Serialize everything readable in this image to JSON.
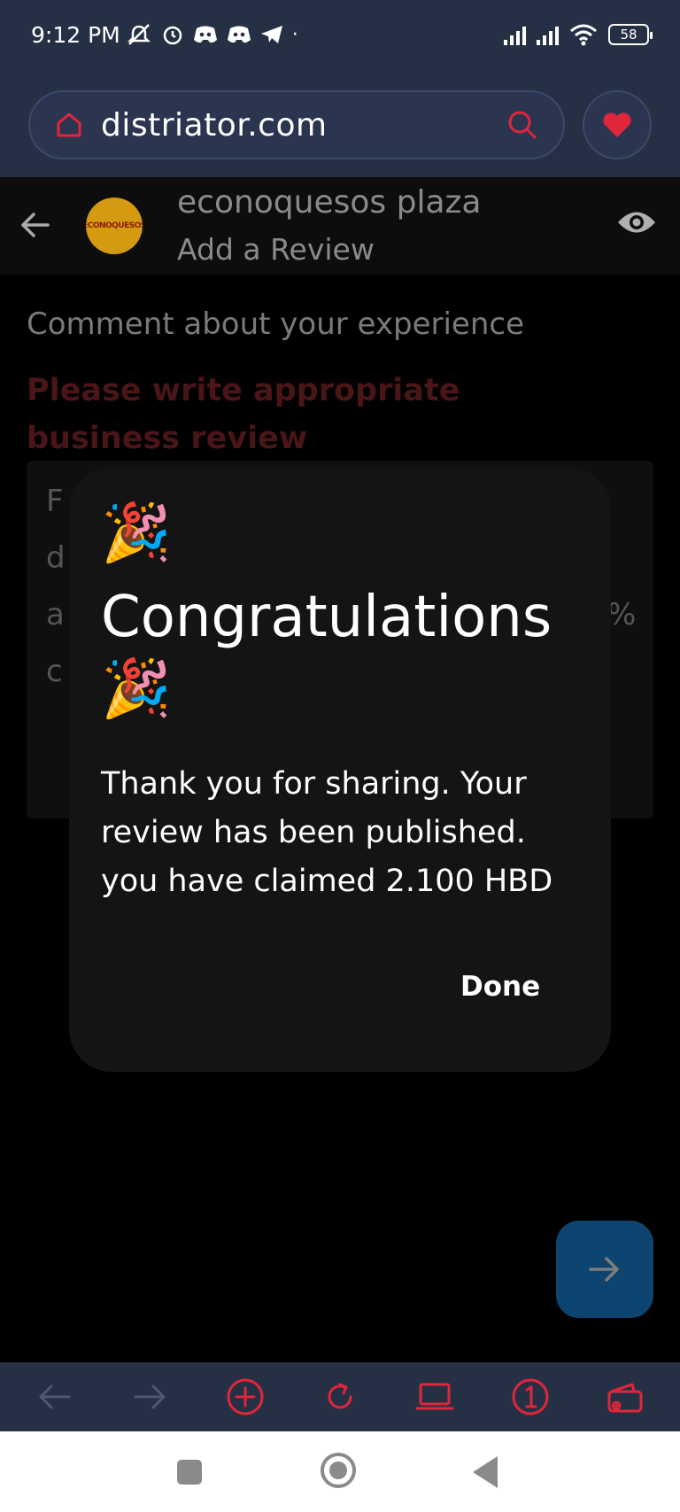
{
  "status_bar": {
    "time": "9:12 PM",
    "battery": "58"
  },
  "browser": {
    "url": "distriator.com"
  },
  "page_header": {
    "business_name": "econoquesos plaza",
    "subtitle": "Add a Review",
    "logo_text": "ECONOQUESOS"
  },
  "form": {
    "comment_label": "Comment about your experience",
    "warning": "Please write appropriate business review",
    "review_text_fragments": [
      "F",
      "d",
      "a",
      "c",
      "%"
    ]
  },
  "modal": {
    "confetti_top": "🎉",
    "title": "Congratulations",
    "confetti_bottom": "🎉",
    "message": "Thank you for sharing. Your review has been published. you have claimed 2.100 HBD",
    "done_label": "Done"
  },
  "colors": {
    "accent": "#e0263a",
    "header_bg": "#263045",
    "fab": "#0e4570"
  },
  "icons": {
    "toolbar": [
      "back-arrow-icon",
      "forward-arrow-icon",
      "add-tab-icon",
      "reload-icon",
      "desktop-mode-icon",
      "tab-count-icon",
      "wallet-icon"
    ]
  }
}
